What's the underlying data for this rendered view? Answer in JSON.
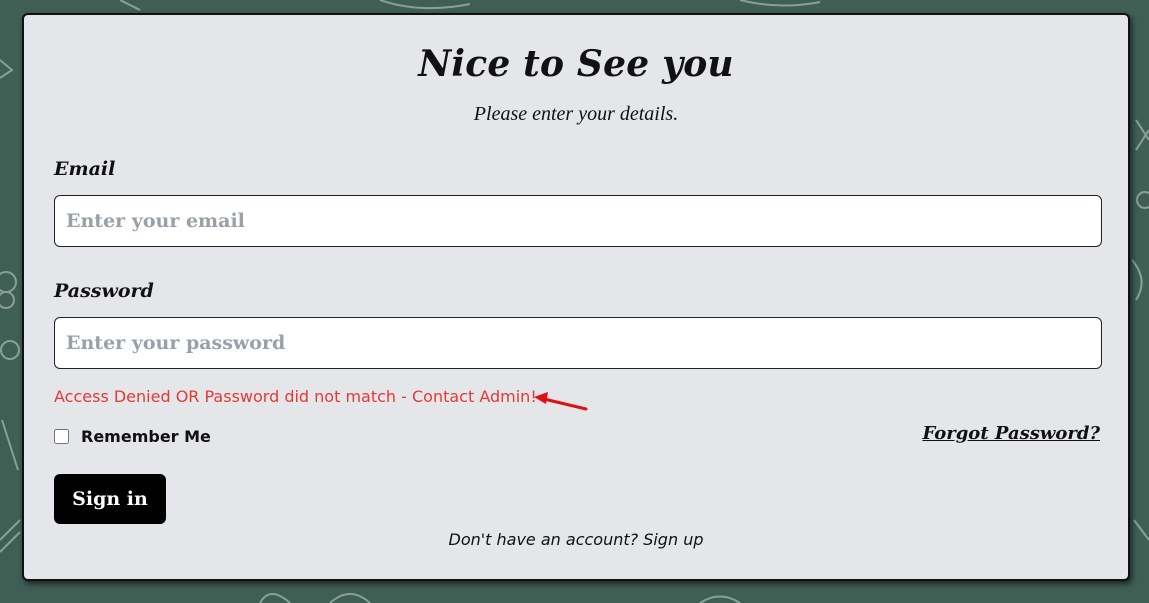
{
  "login": {
    "title": "Nice to See you",
    "subtitle": "Please enter your details.",
    "email_label": "Email",
    "email_placeholder": "Enter your email",
    "email_value": "",
    "password_label": "Password",
    "password_placeholder": "Enter your password",
    "password_value": "",
    "error_message": "Access Denied OR Password did not match - Contact Admin!",
    "remember_label": "Remember Me",
    "remember_checked": false,
    "forgot_link": "Forgot Password?",
    "signin_button": "Sign in",
    "signup_text": "Don't have an account? Sign up"
  },
  "icons": {
    "error_pointer": "red-arrow-icon",
    "background": "chalkboard-doodle-pattern"
  },
  "colors": {
    "background": "#3f5f55",
    "card": "#e5e6ea",
    "error": "#e53935",
    "button": "#000000",
    "arrow": "#e01010"
  }
}
